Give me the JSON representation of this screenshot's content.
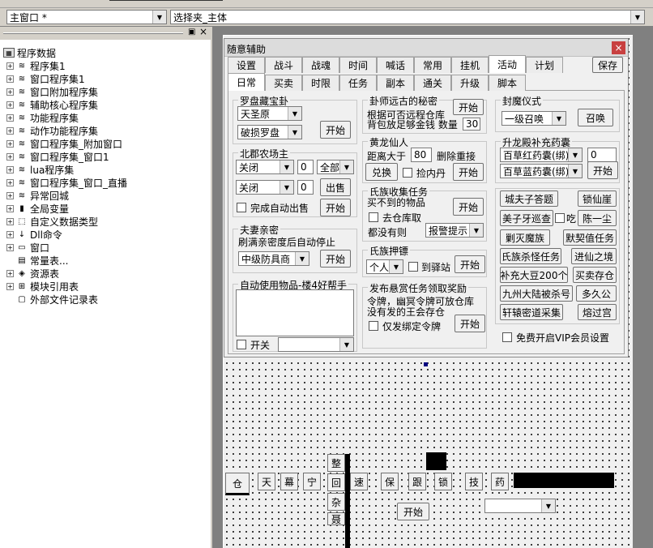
{
  "toolbar": {
    "window_select": "主窗口 *",
    "control_select": "选择夹_主体"
  },
  "tree": {
    "root": "程序数据",
    "items": [
      {
        "label": "程序集1",
        "icon": "module-icon"
      },
      {
        "label": "窗口程序集1",
        "icon": "module-icon"
      },
      {
        "label": "窗口附加程序集",
        "icon": "module-icon"
      },
      {
        "label": "辅助核心程序集",
        "icon": "module-icon"
      },
      {
        "label": "功能程序集",
        "icon": "module-icon"
      },
      {
        "label": "动作功能程序集",
        "icon": "module-icon"
      },
      {
        "label": "窗口程序集_附加窗口",
        "icon": "module-icon"
      },
      {
        "label": "窗口程序集_窗口1",
        "icon": "module-icon"
      },
      {
        "label": "lua程序集",
        "icon": "module-icon"
      },
      {
        "label": "窗口程序集_窗口_直播",
        "icon": "module-icon"
      },
      {
        "label": "异常回城",
        "icon": "module-icon"
      },
      {
        "label": "全局变量",
        "icon": "global-var-icon"
      },
      {
        "label": "自定义数据类型",
        "icon": "datatype-icon"
      },
      {
        "label": "Dll命令",
        "icon": "dll-icon"
      },
      {
        "label": "窗口",
        "icon": "window-icon"
      },
      {
        "label": "常量表...",
        "icon": "constant-icon"
      },
      {
        "label": "资源表",
        "icon": "resource-icon"
      },
      {
        "label": "模块引用表",
        "icon": "module-ref-icon"
      },
      {
        "label": "外部文件记录表",
        "icon": "file-record-icon"
      }
    ]
  },
  "panel_buttons": {
    "pin": "▣",
    "close": "×"
  },
  "window": {
    "title": "随意辅助",
    "close": "×",
    "tabs_row1": [
      "设置",
      "战斗",
      "战魂",
      "时间",
      "喊话",
      "常用",
      "挂机",
      "活动",
      "计划"
    ],
    "save": "保存",
    "tabs_row2": [
      "日常",
      "买卖",
      "时限",
      "任务",
      "副本",
      "通关",
      "升级",
      "脚本"
    ],
    "luopan": {
      "title": "罗盘藏宝卦",
      "sel1": "天圣原",
      "sel2": "破损罗盘",
      "start": "开始"
    },
    "farm": {
      "title": "北郡农场主",
      "sel1": "关闭",
      "val1": "0",
      "sel_all": "全部",
      "sel2": "关闭",
      "val2": "0",
      "sell": "出售",
      "auto_label": "完成自动出售",
      "start": "开始"
    },
    "couple": {
      "title": "夫妻亲密",
      "desc": "刷满亲密度后自动停止",
      "sel": "中级防具商",
      "start": "开始"
    },
    "auto_use": {
      "title": "自动使用物品-楼4好帮手",
      "switch_label": "开关"
    },
    "fengshi": {
      "title": "卦师远古的秘密",
      "line1": "根据可否远程仓库",
      "line2": "背包放足够金钱 数量",
      "qty": "30",
      "start": "开始"
    },
    "huanglong": {
      "title": "黄龙仙人",
      "dist_label": "距离大于",
      "dist": "80",
      "delete_label": "删除重接",
      "exchange": "兑换",
      "pickup_label": "捡内丹",
      "start": "开始"
    },
    "clan_collect": {
      "title": "氏族收集任务",
      "desc": "买不到的物品",
      "start": "开始",
      "warehouse_label": "去仓库取",
      "none_label": "都没有则",
      "alarm_sel": "报警提示"
    },
    "clan_escort": {
      "title": "氏族押镖",
      "sel": "个人",
      "station_label": "到驿站",
      "start": "开始"
    },
    "bounty": {
      "title": "发布悬赏任务领取奖励",
      "line1": "令牌，幽冥令牌可放仓库",
      "line2": "没有发的王会存仓",
      "bind_label": "仅发绑定令牌",
      "start": "开始"
    },
    "ceremony": {
      "title": "封魔仪式",
      "sel": "一级召唤",
      "summon": "召唤"
    },
    "dragon": {
      "title": "升龙殿补充药囊",
      "sel1": "百草红药囊(绑)",
      "val1": "0",
      "sel2": "百草蓝药囊(绑)",
      "start": "开始"
    },
    "quick": {
      "b1": "城夫子答题",
      "b2": "锁仙崖",
      "b3": "美子牙巡查",
      "b3_chk": "吃",
      "b4": "陈一尘",
      "b5": "剿灭魔族",
      "b6": "默契值任务",
      "b7": "氏族杀怪任务",
      "b8": "进仙之境",
      "b9": "补充大豆200个",
      "b10": "买卖存仓",
      "b11": "九州大陆被杀号",
      "b12": "多久公",
      "b13": "轩辕密道采集",
      "b14": "熔过宫"
    },
    "vip_label": "免费开启VIP会员设置"
  },
  "design": {
    "vert_buttons": [
      "整",
      "回",
      "杂",
      "聂"
    ],
    "row_buttons": [
      "仓",
      "天",
      "幕",
      "宁",
      "速",
      "保",
      "跟",
      "锁",
      "技",
      "药"
    ],
    "start": "开始"
  }
}
